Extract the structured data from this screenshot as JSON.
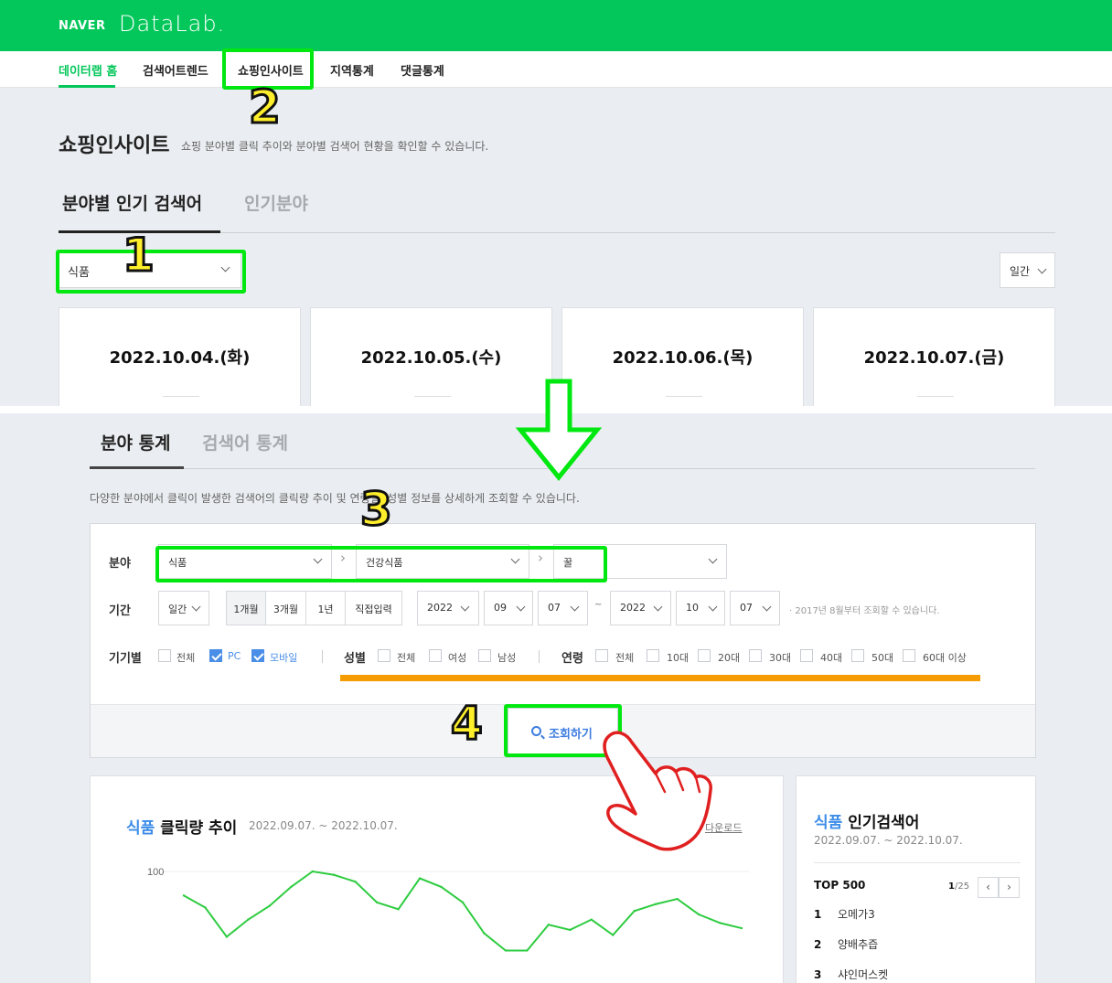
{
  "header": {
    "naver": "NAVER",
    "datalab": "DataLab",
    "datalab_dot": "."
  },
  "gnb": [
    {
      "label": "데이터랩 홈",
      "active": true
    },
    {
      "label": "검색어트렌드"
    },
    {
      "label": "쇼핑인사이트"
    },
    {
      "label": "지역통계"
    },
    {
      "label": "댓글통계"
    }
  ],
  "page": {
    "title": "쇼핑인사이트",
    "desc": "쇼핑 분야별 클릭 추이와 분야별 검색어 현황을 확인할 수 있습니다."
  },
  "top_tabs": {
    "tab1": "분야별 인기 검색어",
    "tab2": "인기분야"
  },
  "top_filters": {
    "category": "식품",
    "period": "일간"
  },
  "date_cards": [
    "2022.10.04.(화)",
    "2022.10.05.(수)",
    "2022.10.06.(목)",
    "2022.10.07.(금)"
  ],
  "annotations": {
    "n1": "1",
    "n2": "2",
    "n3": "3",
    "n4": "4"
  },
  "bottom_tabs": {
    "tab1": "분야 통계",
    "tab2": "검색어 통계"
  },
  "bottom_desc": "다양한 분야에서 클릭이 발생한 검색어의 클릭량 추이 및 연령별, 성별 정보를 상세하게 조회할 수 있습니다.",
  "filter": {
    "category_label": "분야",
    "cat1": "식품",
    "cat2": "건강식품",
    "cat3": "꿀",
    "cat4": "",
    "period_label": "기간",
    "period_unit": "일간",
    "range_buttons": [
      "1개월",
      "3개월",
      "1년",
      "직접입력"
    ],
    "start": {
      "year": "2022",
      "month": "09",
      "day": "07"
    },
    "tilde": "~",
    "end": {
      "year": "2022",
      "month": "10",
      "day": "07"
    },
    "note": "· 2017년 8월부터 조회할 수 있습니다.",
    "device_label": "기기별",
    "device": [
      "전체",
      "PC",
      "모바일"
    ],
    "gender_label": "성별",
    "gender": [
      "전체",
      "여성",
      "남성"
    ],
    "age_label": "연령",
    "age": [
      "전체",
      "10대",
      "20대",
      "30대",
      "40대",
      "50대",
      "60대 이상"
    ],
    "search_button": "조회하기"
  },
  "chart_card": {
    "title_acc": "식품",
    "title": " 클릭량 추이",
    "range": "2022.09.07. ~ 2022.10.07.",
    "download": "다운로드",
    "y_label_100": "100"
  },
  "chart_data": {
    "type": "line",
    "title": "식품 클릭량 추이",
    "ylim": [
      0,
      100
    ],
    "series": [
      {
        "values": [
          86,
          79,
          62,
          72,
          80,
          91,
          100,
          98,
          94,
          82,
          78,
          96,
          91,
          82,
          64,
          54,
          54,
          69,
          66,
          72,
          63,
          77,
          81,
          84,
          75,
          70,
          67
        ]
      }
    ]
  },
  "side_card": {
    "title_acc": "식품",
    "title": " 인기검색어",
    "range": "2022.09.07. ~ 2022.10.07.",
    "top500": "TOP 500",
    "page_cur": "1",
    "page_total": "/25",
    "prev": "‹",
    "next": "›",
    "ranks": [
      {
        "n": "1",
        "kw": "오메가3"
      },
      {
        "n": "2",
        "kw": "양배추즙"
      },
      {
        "n": "3",
        "kw": "샤인머스켓"
      }
    ]
  }
}
